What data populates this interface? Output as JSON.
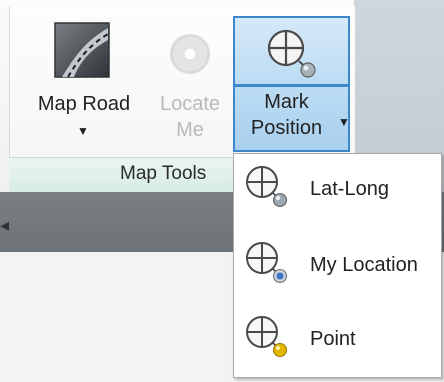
{
  "ribbon": {
    "panel_title": "Map Tools",
    "buttons": {
      "map_road": {
        "label": "Map Road",
        "icon": "road-icon"
      },
      "locate_me": {
        "label_line1": "Locate",
        "label_line2": "Me",
        "icon": "locate-icon",
        "enabled": false
      },
      "mark_position": {
        "label_line1": "Mark",
        "label_line2": "Position",
        "icon": "crosshair-globe-icon"
      }
    }
  },
  "dropdown": {
    "items": [
      {
        "label": "Lat-Long",
        "icon": "crosshair-globe-icon",
        "badge_color": "#9aa7ae"
      },
      {
        "label": "My Location",
        "icon": "crosshair-location-icon",
        "badge_color": "#3a77c6"
      },
      {
        "label": "Point",
        "icon": "crosshair-point-icon",
        "badge_color": "#e2b500"
      }
    ]
  },
  "colors": {
    "accent": "#3c86c9",
    "accent_fill": "#bcdcf3",
    "dark_band": "#767b80"
  }
}
